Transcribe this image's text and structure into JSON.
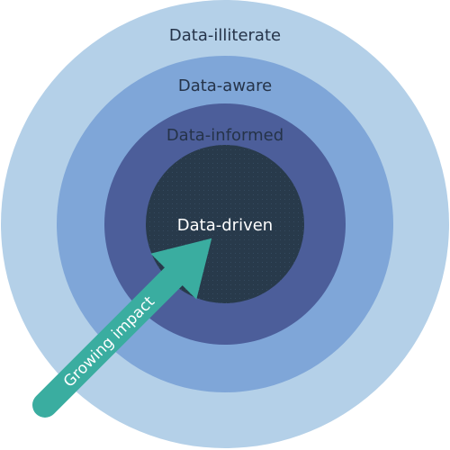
{
  "diagram": {
    "rings": [
      {
        "label": "Data-illiterate",
        "fill": "#b4d0e8",
        "text_color": "#253349"
      },
      {
        "label": "Data-aware",
        "fill": "#7fa6d8",
        "text_color": "#253349"
      },
      {
        "label": "Data-informed",
        "fill": "#4c5e9a",
        "text_color": "#253349"
      },
      {
        "label": "Data-driven",
        "fill": "#283a4b",
        "text_color": "#ffffff"
      }
    ],
    "arrow": {
      "label": "Growing impact",
      "fill": "#3aada0",
      "text_color": "#ffffff"
    },
    "background": "#ffffff"
  }
}
